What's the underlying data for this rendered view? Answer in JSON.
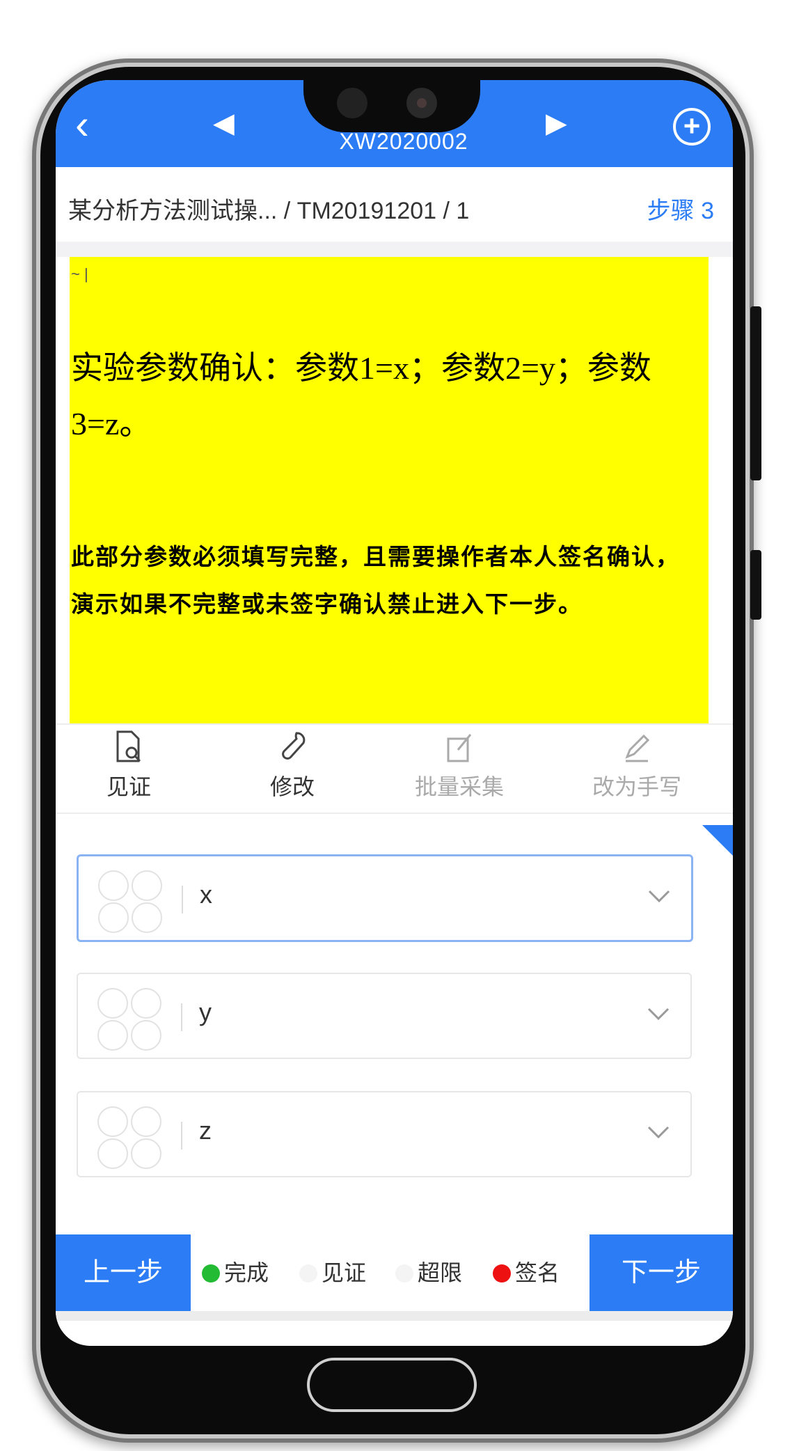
{
  "header": {
    "back_icon": "‹",
    "prev_icon": "◀",
    "next_icon": "▶",
    "title": "XW2020002",
    "add_icon": "+"
  },
  "breadcrumb": {
    "path": "某分析方法测试操... / TM20191201 / 1",
    "step": "步骤 3"
  },
  "content": {
    "marker": "~ |",
    "title": "实验参数确认：参数1=x；参数2=y；参数3=z。",
    "body": "此部分参数必须填写完整，且需要操作者本人签名确认，演示如果不完整或未签字确认禁止进入下一步。"
  },
  "toolbar": [
    {
      "label": "见证",
      "icon": "document-search-icon"
    },
    {
      "label": "修改",
      "icon": "wrench-icon"
    },
    {
      "label": "批量采集",
      "icon": "batch-collect-icon"
    },
    {
      "label": "改为手写",
      "icon": "pen-icon"
    }
  ],
  "fields": [
    {
      "value": "x",
      "active": true
    },
    {
      "value": "y",
      "active": false
    },
    {
      "value": "z",
      "active": false
    }
  ],
  "bottom": {
    "prev_label": "上一步",
    "next_label": "下一步",
    "legend": [
      {
        "label": "完成",
        "color": "#22bb33"
      },
      {
        "label": "见证",
        "color": "#f4f4f4"
      },
      {
        "label": "超限",
        "color": "#f4f4f4"
      },
      {
        "label": "签名",
        "color": "#ee1111"
      }
    ]
  },
  "colors": {
    "accent": "#2b7cf5",
    "highlight": "#ffff00"
  }
}
